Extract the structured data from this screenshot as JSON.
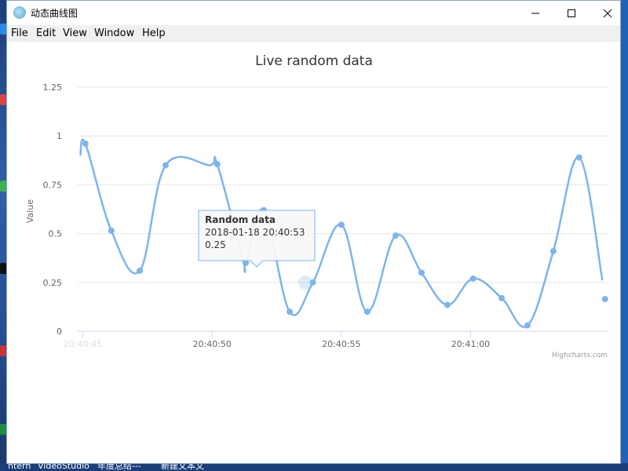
{
  "window": {
    "title": "动态曲线图",
    "icon": "app-globe-icon"
  },
  "window_controls": {
    "minimize": "—",
    "maximize": "☐",
    "close": "✕"
  },
  "menu": [
    "File",
    "Edit",
    "View",
    "Window",
    "Help"
  ],
  "taskbar": {
    "items": [
      "ntern",
      "VideoStudio",
      "年度总结---",
      "新建文本文"
    ]
  },
  "chart_data": {
    "type": "line",
    "title": "Live random data",
    "ylabel": "Value",
    "ylim": [
      0,
      1.25
    ],
    "yticks": [
      "0",
      "0.25",
      "0.5",
      "0.75",
      "1",
      "1.25"
    ],
    "xticks": [
      "20:40:45",
      "20:40:50",
      "20:40:55",
      "20:41:00"
    ],
    "xlim": [
      44.8,
      65.3
    ],
    "series": [
      {
        "name": "Random data",
        "color": "#7cb5ec",
        "points": [
          {
            "t": 44.9,
            "v": 0.9
          },
          {
            "t": 45.1,
            "v": 0.96
          },
          {
            "t": 46.1,
            "v": 0.515
          },
          {
            "t": 47.2,
            "v": 0.31
          },
          {
            "t": 48.2,
            "v": 0.85
          },
          {
            "t": 49.9,
            "v": 0.85
          },
          {
            "t": 50.2,
            "v": 0.855
          },
          {
            "t": 51.2,
            "v": 0.36
          },
          {
            "t": 51.3,
            "v": 0.35
          },
          {
            "t": 52.0,
            "v": 0.62
          },
          {
            "t": 53.0,
            "v": 0.1
          },
          {
            "t": 53.9,
            "v": 0.25
          },
          {
            "t": 55.0,
            "v": 0.545
          },
          {
            "t": 56.0,
            "v": 0.1
          },
          {
            "t": 57.1,
            "v": 0.49
          },
          {
            "t": 58.1,
            "v": 0.3
          },
          {
            "t": 59.1,
            "v": 0.135
          },
          {
            "t": 60.1,
            "v": 0.27
          },
          {
            "t": 61.2,
            "v": 0.17
          },
          {
            "t": 62.2,
            "v": 0.03
          },
          {
            "t": 63.2,
            "v": 0.41
          },
          {
            "t": 64.2,
            "v": 0.89
          },
          {
            "t": 65.1,
            "v": 0.26
          }
        ],
        "markers": [
          45.1,
          46.1,
          47.2,
          48.2,
          50.2,
          51.3,
          52.0,
          53.0,
          53.9,
          55.0,
          56.0,
          57.1,
          58.1,
          59.1,
          60.1,
          61.2,
          62.2,
          63.2,
          64.2
        ],
        "extra_marker": {
          "t": 65.2,
          "v": 0.165
        },
        "hover_point": {
          "t": 53.6,
          "v": 0.25
        }
      }
    ],
    "tooltip": {
      "series": "Random data",
      "time": "2018-01-18 20:40:53",
      "value": "0.25"
    },
    "credits": "Highcharts.com",
    "grid": true,
    "legend": "none"
  }
}
